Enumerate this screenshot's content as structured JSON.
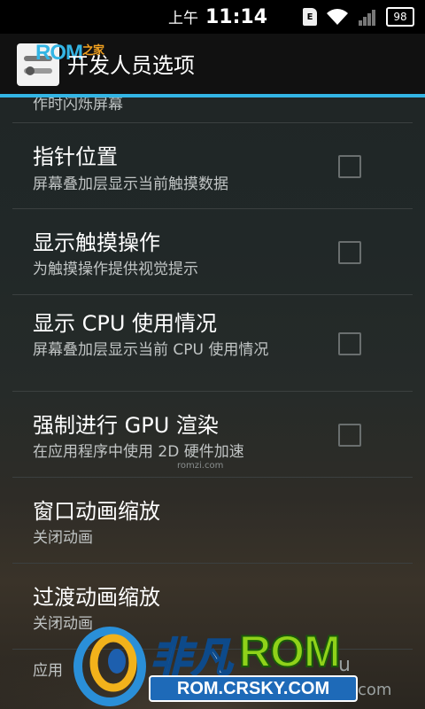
{
  "status_bar": {
    "ampm": "上午",
    "time": "11:14",
    "sim_label": "E",
    "battery_level": "98"
  },
  "action_bar": {
    "title": "开发人员选项",
    "watermark_main": "ROM",
    "watermark_sub": "之家"
  },
  "list": {
    "partial_top": "作时闪烁屏幕",
    "items": [
      {
        "label": "指针位置",
        "summary": "屏幕叠加层显示当前触摸数据",
        "checked": false
      },
      {
        "label": "显示触摸操作",
        "summary": "为触摸操作提供视觉提示",
        "checked": false
      },
      {
        "label": "显示 CPU 使用情况",
        "summary": "屏幕叠加层显示当前 CPU 使用情况",
        "checked": false
      },
      {
        "label": "强制进行 GPU 渲染",
        "summary": "在应用程序中使用 2D 硬件加速",
        "checked": false
      },
      {
        "label": "窗口动画缩放",
        "summary": "关闭动画"
      },
      {
        "label": "过渡动画缩放",
        "summary": "关闭动画"
      },
      {
        "label": "应用"
      }
    ]
  },
  "watermarks": {
    "romzi": "romzi.com",
    "feifan_cn": "非凡",
    "feifan_rom": "ROM",
    "feifan_url": "ROM.CRSKY.COM",
    "feifan_tail": "u",
    "feifan_com": "com"
  },
  "colors": {
    "accent": "#33b5e5",
    "checkbox_border": "#6a6f6f",
    "divider": "#3b4040"
  }
}
